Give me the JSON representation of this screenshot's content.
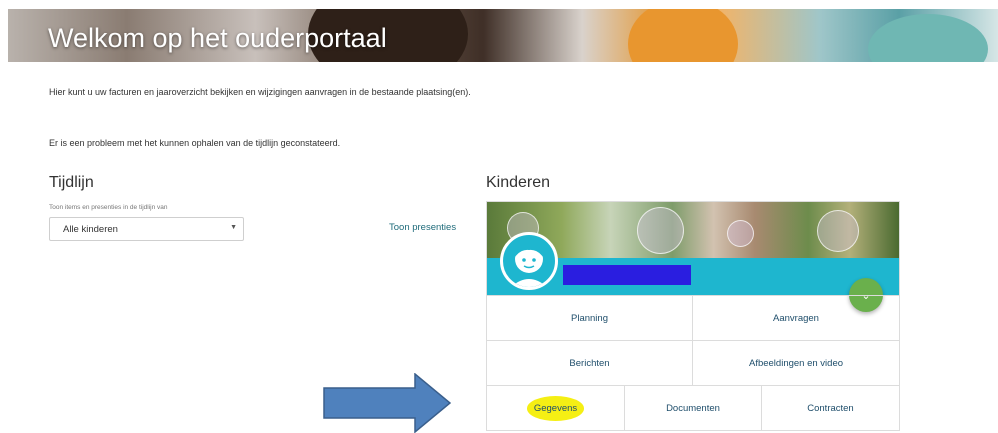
{
  "banner": {
    "title": "Welkom op het ouderportaal"
  },
  "intro_text": "Hier kunt u uw facturen en jaaroverzicht bekijken en wijzigingen aanvragen in de bestaande plaatsing(en).",
  "error_text": "Er is een probleem met het kunnen ophalen van de tijdlijn geconstateerd.",
  "timeline": {
    "title": "Tijdlijn",
    "filter_label": "Toon items en presenties in de tijdlijn van",
    "filter_value": "Alle kinderen",
    "toon_presenties": "Toon presenties"
  },
  "kinderen": {
    "title": "Kinderen",
    "actions": {
      "planning": "Planning",
      "aanvragen": "Aanvragen",
      "berichten": "Berichten",
      "afbeeldingen": "Afbeeldingen en video",
      "gegevens": "Gegevens",
      "documenten": "Documenten",
      "contracten": "Contracten"
    }
  },
  "colors": {
    "accent_cyan": "#1eb6cf",
    "fab_green": "#6ab04c",
    "highlight_yellow": "#f5ef14",
    "arrow_blue": "#4f81bd"
  }
}
